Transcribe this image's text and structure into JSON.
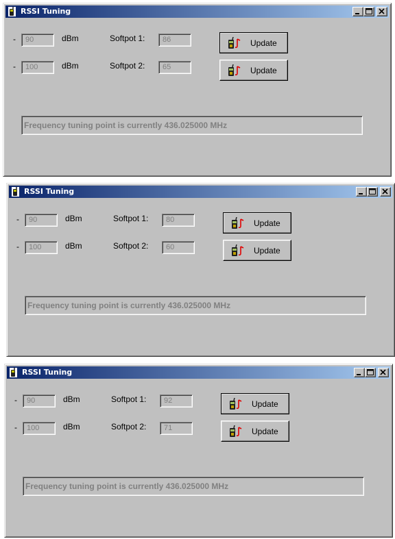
{
  "windows": [
    {
      "title": "RSSI Tuning",
      "rows": [
        {
          "sign": "-",
          "dbm_value": "90",
          "unit": "dBm",
          "softpot_label": "Softpot 1:",
          "softpot_value": "86",
          "button_label": "Update"
        },
        {
          "sign": "-",
          "dbm_value": "100",
          "unit": "dBm",
          "softpot_label": "Softpot 2:",
          "softpot_value": "65",
          "button_label": "Update"
        }
      ],
      "status": "Frequency tuning point is currently 436.025000 MHz"
    },
    {
      "title": "RSSI Tuning",
      "rows": [
        {
          "sign": "-",
          "dbm_value": "90",
          "unit": "dBm",
          "softpot_label": "Softpot 1:",
          "softpot_value": "80",
          "button_label": "Update"
        },
        {
          "sign": "-",
          "dbm_value": "100",
          "unit": "dBm",
          "softpot_label": "Softpot 2:",
          "softpot_value": "60",
          "button_label": "Update"
        }
      ],
      "status": "Frequency tuning point is currently 436.025000 MHz"
    },
    {
      "title": "RSSI Tuning",
      "rows": [
        {
          "sign": "-",
          "dbm_value": "90",
          "unit": "dBm",
          "softpot_label": "Softpot 1:",
          "softpot_value": "92",
          "button_label": "Update"
        },
        {
          "sign": "-",
          "dbm_value": "100",
          "unit": "dBm",
          "softpot_label": "Softpot 2:",
          "softpot_value": "71",
          "button_label": "Update"
        }
      ],
      "status": "Frequency tuning point is currently 436.025000 MHz"
    }
  ],
  "icons": {
    "title_icon": "radio-handset-icon",
    "button_icon": "radio-tuning-icon",
    "minimize": "minimize-icon",
    "maximize": "maximize-icon",
    "close": "close-icon"
  },
  "colors": {
    "face": "#c0c0c0",
    "title_gradient_start": "#0a246a",
    "title_gradient_end": "#a6caf0",
    "disabled_text": "#808080",
    "accent_red": "#e00000"
  }
}
